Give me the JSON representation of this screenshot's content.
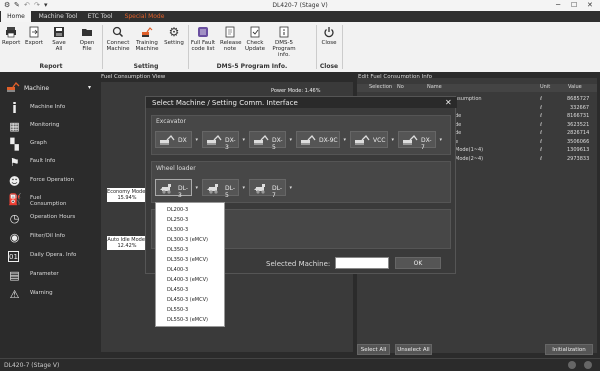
{
  "window": {
    "title": "DL420-7 (Stage V)"
  },
  "tabs": [
    {
      "label": "Home"
    },
    {
      "label": "Machine Tool"
    },
    {
      "label": "ETC Tool"
    },
    {
      "label": "Special Mode"
    }
  ],
  "ribbon": {
    "report": {
      "label": "Report"
    },
    "export": {
      "label": "Export"
    },
    "save_all": {
      "label": "Save All"
    },
    "open_file": {
      "label": "Open File"
    },
    "connect_machine": {
      "label": "Connect Machine"
    },
    "training_machine": {
      "label": "Training Machine"
    },
    "setting": {
      "label": "Setting"
    },
    "full_fault": {
      "label": "Full Fault code list"
    },
    "release_note": {
      "label": "Release note"
    },
    "check_update": {
      "label": "Check Update"
    },
    "dms5_info": {
      "label": "DMS-5 Program info."
    },
    "close": {
      "label": "Close"
    },
    "groups": {
      "report": "Report",
      "setting": "Setting",
      "dms": "DMS-5 Program Info.",
      "close": "Close"
    }
  },
  "sidebar": {
    "machine_label": "Machine",
    "items": [
      {
        "label": "Machine Info"
      },
      {
        "label": "Monitoring"
      },
      {
        "label": "Graph"
      },
      {
        "label": "Fault Info"
      },
      {
        "label": "Force Operation"
      },
      {
        "label": "Fuel Consumption"
      },
      {
        "label": "Operation Hours"
      },
      {
        "label": "Filter/Oil Info"
      },
      {
        "label": "Daily Opera. Info"
      },
      {
        "label": "Parameter"
      },
      {
        "label": "Warning"
      }
    ]
  },
  "fuel_view": {
    "title": "Fuel Consumption View",
    "power_mode": "Power Mode: 1.46%",
    "economy_mode": "Economy Mode: 15.94%",
    "auto_idle": "Auto Idle Mode: 12.42%"
  },
  "edit_panel": {
    "title": "Edit Fuel Consumption Info",
    "headers": {
      "selection": "Selection",
      "no": "No",
      "name": "Name",
      "unit": "Unit",
      "value": "Value"
    },
    "rows": [
      {
        "name": "nsumption",
        "unit": "ℓ",
        "value": "8685727"
      },
      {
        "name": "",
        "unit": "ℓ",
        "value": "332667"
      },
      {
        "name": "de",
        "unit": "ℓ",
        "value": "8166731"
      },
      {
        "name": "de",
        "unit": "ℓ",
        "value": "3623521"
      },
      {
        "name": "de",
        "unit": "ℓ",
        "value": "2826714"
      },
      {
        "name": "e",
        "unit": "ℓ",
        "value": "3506066"
      },
      {
        "name": "Mode(1~4)",
        "unit": "ℓ",
        "value": "1309613"
      },
      {
        "name": "Mode(2~4)",
        "unit": "ℓ",
        "value": "2973833"
      }
    ],
    "select_all": "Select All",
    "unselect_all": "Unselect All",
    "initialization": "Initialization"
  },
  "modal": {
    "title": "Select Machine / Setting Comm. Interface",
    "excavator_label": "Excavator",
    "excavators": [
      "DX",
      "DX-3",
      "DX-5",
      "DX-9C",
      "VCC",
      "DX-7"
    ],
    "wheel_loader_label": "Wheel loader",
    "wheel_loaders": [
      "DL-3",
      "DL-5",
      "DL-7"
    ],
    "selected_machine_label": "Selected Machine:",
    "selected_machine_value": "",
    "ok": "OK"
  },
  "dropdown": {
    "items": [
      "DL200-3",
      "DL250-3",
      "DL300-3",
      "DL300-3 (eMCV)",
      "DL350-3",
      "DL350-3 (eMCV)",
      "DL400-3",
      "DL400-3 (eMCV)",
      "DL450-3",
      "DL450-3 (eMCV)",
      "DL550-3",
      "DL550-3 (eMCV)"
    ]
  },
  "status": {
    "text": "DL420-7 (Stage V)"
  },
  "colors": {
    "accent": "#e0602a",
    "ribbon_bg": "#f2f2f2",
    "dark_bg": "#2b2b2b"
  }
}
